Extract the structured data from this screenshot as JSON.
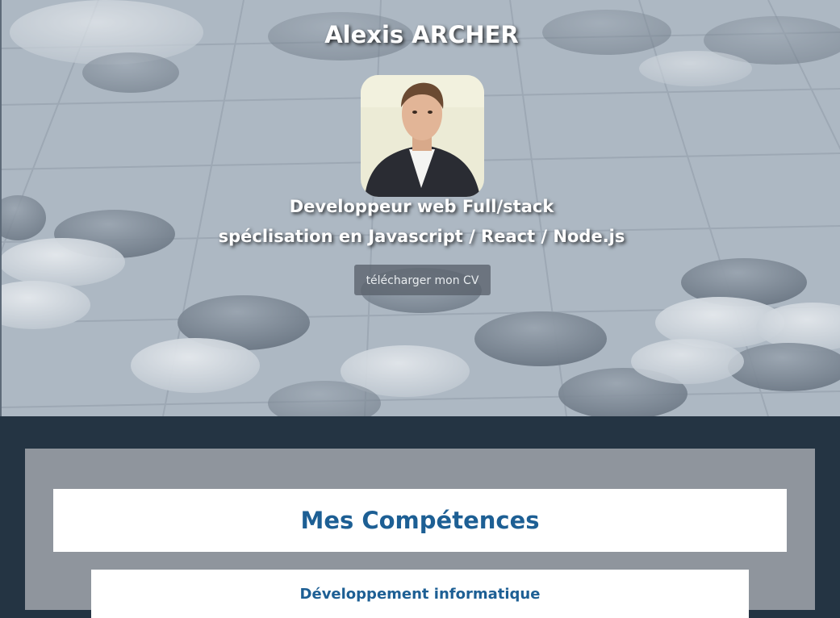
{
  "hero": {
    "name": "Alexis ARCHER",
    "subtitle_line1": "Developpeur web Full/stack",
    "subtitle_line2": "spéclisation en Javascript / React / Node.js",
    "cv_button_label": "télécharger mon CV"
  },
  "skills": {
    "title": "Mes Compétences",
    "card_title": "Développement informatique"
  },
  "colors": {
    "page_bg": "#243443",
    "panel_bg": "#8f959d",
    "heading_blue": "#1d5f94"
  }
}
